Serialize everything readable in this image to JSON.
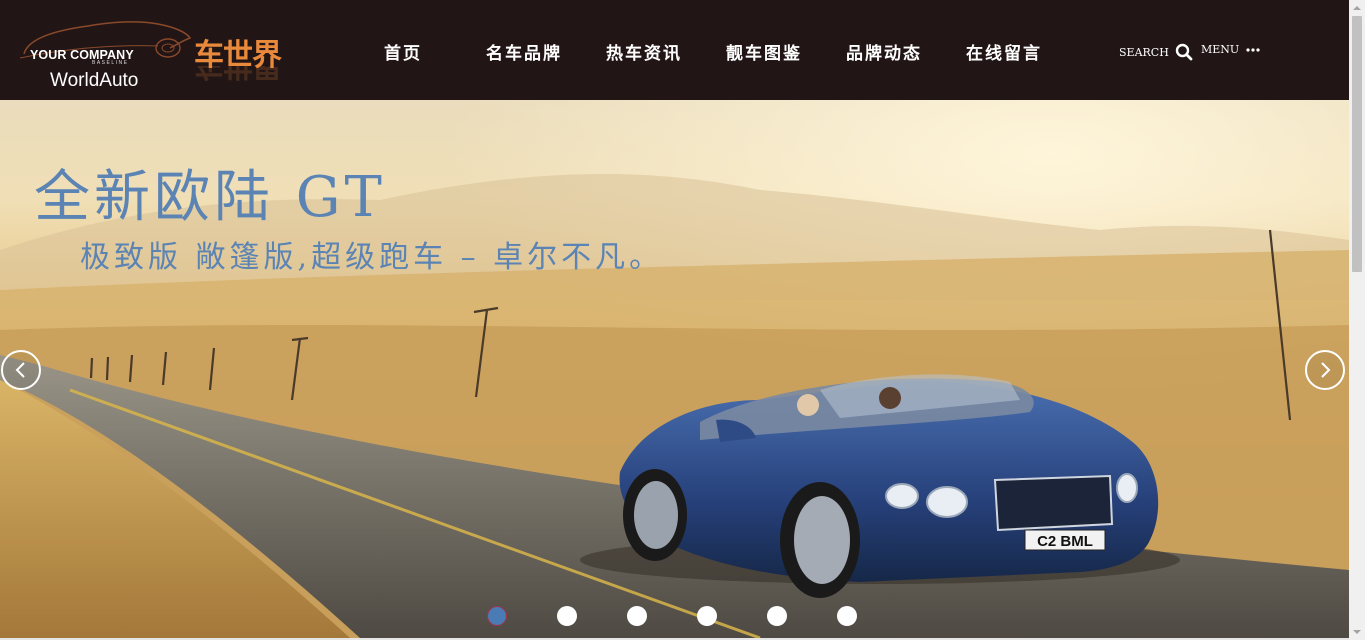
{
  "brand": {
    "company": "YOUR COMPANY",
    "baseline": "BASELINE",
    "name_en": "WorldAuto",
    "name_cn": "车世界",
    "accent_color": "#e8893b"
  },
  "nav": {
    "items": [
      {
        "label": "首页"
      },
      {
        "label": "名车品牌"
      },
      {
        "label": "热车资讯"
      },
      {
        "label": "靓车图鉴"
      },
      {
        "label": "品牌动态"
      },
      {
        "label": "在线留言"
      }
    ]
  },
  "utilities": {
    "search_label": "SEARCH",
    "search_icon": "search-icon",
    "menu_label": "MENU",
    "menu_icon": "more-dots-icon"
  },
  "banner": {
    "title": "全新欧陆 GT",
    "subtitle": "极致版 敞篷版,超级跑车 – 卓尔不凡。",
    "plate": "C2 BML",
    "prev_icon": "chevron-left-icon",
    "next_icon": "chevron-right-icon",
    "slide_count": 6,
    "active_slide": 1,
    "text_color": "#5b84b4",
    "active_dot_color": "#4a7bb4"
  },
  "colors": {
    "header_bg": "#221516"
  }
}
